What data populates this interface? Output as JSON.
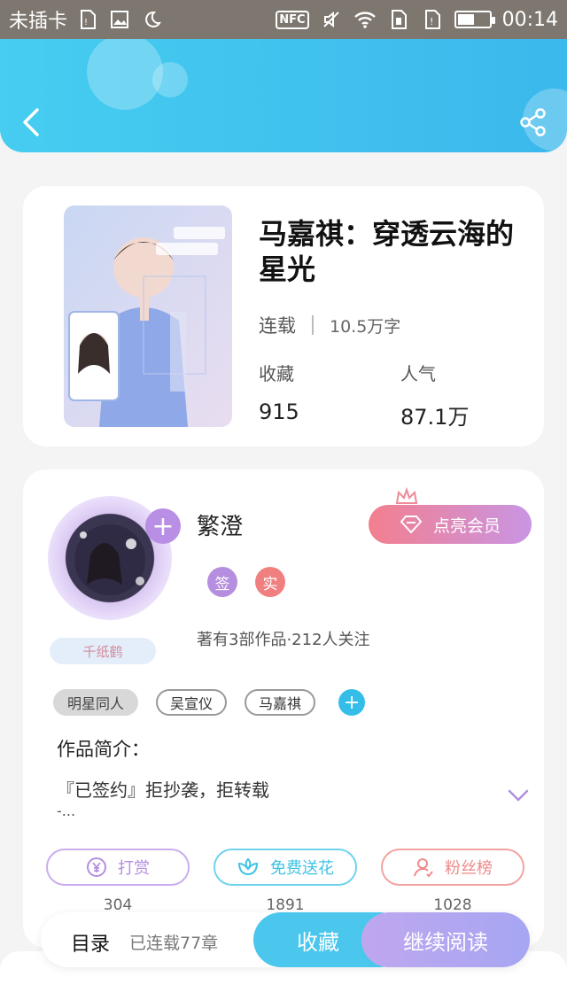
{
  "status_bar": {
    "carrier": "未插卡",
    "nfc_label": "NFC",
    "time": "00:14",
    "battery_level": 0.55
  },
  "header": {
    "back_icon": "chevron-left-icon",
    "share_icon": "share-icon",
    "accent_color": "#3bb8ec"
  },
  "book": {
    "title": "马嘉祺：穿透云海的星光",
    "status": "连载",
    "word_count": "10.5万字",
    "favorites_label": "收藏",
    "favorites_value": "915",
    "popularity_label": "人气",
    "popularity_value": "87.1万"
  },
  "author": {
    "name": "繁澄",
    "level_badge": "千纸鹤",
    "vip_button": "点亮会员",
    "tags": [
      "签",
      "实"
    ],
    "info": "著有3部作品·212人关注"
  },
  "book_tags": {
    "items": [
      "明星同人",
      "吴宣仪",
      "马嘉祺"
    ],
    "add_icon": "plus-icon"
  },
  "intro": {
    "title": "作品简介：",
    "text": "『已签约』拒抄袭，拒转载",
    "more": "-..."
  },
  "actions": [
    {
      "label": "打赏",
      "count": "304",
      "icon": "yen-icon",
      "color": "#b48ee0"
    },
    {
      "label": "免费送花",
      "count": "1891",
      "icon": "flower-icon",
      "color": "#3fc3e6"
    },
    {
      "label": "粉丝榜",
      "count": "1028",
      "icon": "user-icon",
      "color": "#ef8a8a"
    }
  ],
  "bottom_bar": {
    "toc_label": "目录",
    "chapters": "已连载77章",
    "collect_button": "收藏",
    "read_button": "继续阅读"
  }
}
